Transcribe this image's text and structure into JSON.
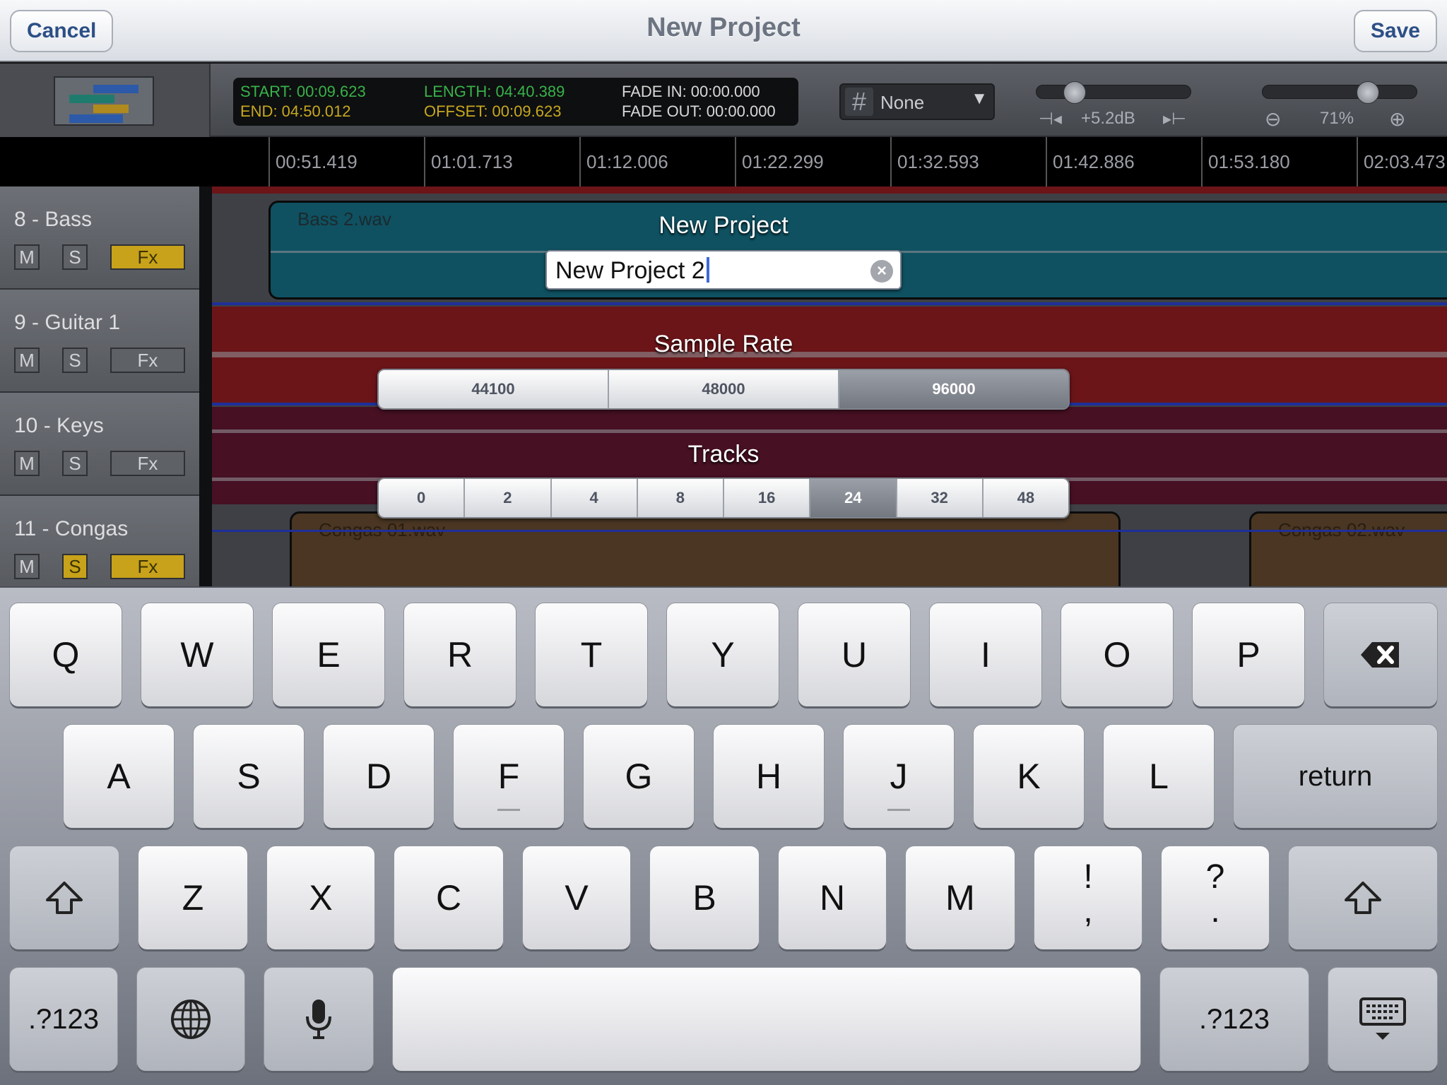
{
  "navbar": {
    "title": "New Project",
    "cancel_label": "Cancel",
    "save_label": "Save"
  },
  "toolbar": {
    "start": "START: 00:09.623",
    "end": "END: 04:50.012",
    "length": "LENGTH: 04:40.389",
    "offset": "OFFSET: 00:09.623",
    "fade_in": "FADE IN: 00:00.000",
    "fade_out": "FADE OUT: 00:00.000",
    "snap_value": "None",
    "gain_value": "+5.2dB",
    "gain_level": 0.2,
    "zoom_value": "71%",
    "zoom_level": 0.71
  },
  "ruler": {
    "ticks": [
      "00:51.419",
      "01:01.713",
      "01:12.006",
      "01:22.299",
      "01:32.593",
      "01:42.886",
      "01:53.180",
      "02:03.473"
    ]
  },
  "tracks": [
    {
      "name": "8 - Bass",
      "mute": "M",
      "solo": "S",
      "fx": "Fx",
      "solo_on": false,
      "fx_on": true,
      "clip": "Bass 2.wav"
    },
    {
      "name": "9 - Guitar 1",
      "mute": "M",
      "solo": "S",
      "fx": "Fx",
      "solo_on": false,
      "fx_on": false
    },
    {
      "name": "10 - Keys",
      "mute": "M",
      "solo": "S",
      "fx": "Fx",
      "solo_on": false,
      "fx_on": false
    },
    {
      "name": "11 - Congas",
      "mute": "M",
      "solo": "S",
      "fx": "Fx",
      "solo_on": true,
      "fx_on": true,
      "clip": "Congas 01.wav",
      "clip2": "Congas 02.wav"
    }
  ],
  "dialog": {
    "name_label": "New Project",
    "name_value": "New Project 2",
    "sample_rate_label": "Sample Rate",
    "sample_rates": [
      "44100",
      "48000",
      "96000"
    ],
    "sample_rate_selected": "96000",
    "tracks_label": "Tracks",
    "track_counts": [
      "0",
      "2",
      "4",
      "8",
      "16",
      "24",
      "32",
      "48"
    ],
    "track_count_selected": "24"
  },
  "keyboard": {
    "row1": [
      "Q",
      "W",
      "E",
      "R",
      "T",
      "Y",
      "U",
      "I",
      "O",
      "P"
    ],
    "row2": [
      "A",
      "S",
      "D",
      "F",
      "G",
      "H",
      "J",
      "K",
      "L"
    ],
    "row3": [
      "Z",
      "X",
      "C",
      "V",
      "B",
      "N",
      "M"
    ],
    "return_label": "return",
    "numbers_label": ".?123",
    "punct1_top": "!",
    "punct1_bottom": ",",
    "punct2_top": "?",
    "punct2_bottom": "."
  },
  "colors": {
    "bass_lane": "#0f5161",
    "guitar_lane": "#6b1519",
    "keys_lane": "#471023",
    "congas_clip": "#4a3622",
    "selected_segment": "#7b8088"
  }
}
